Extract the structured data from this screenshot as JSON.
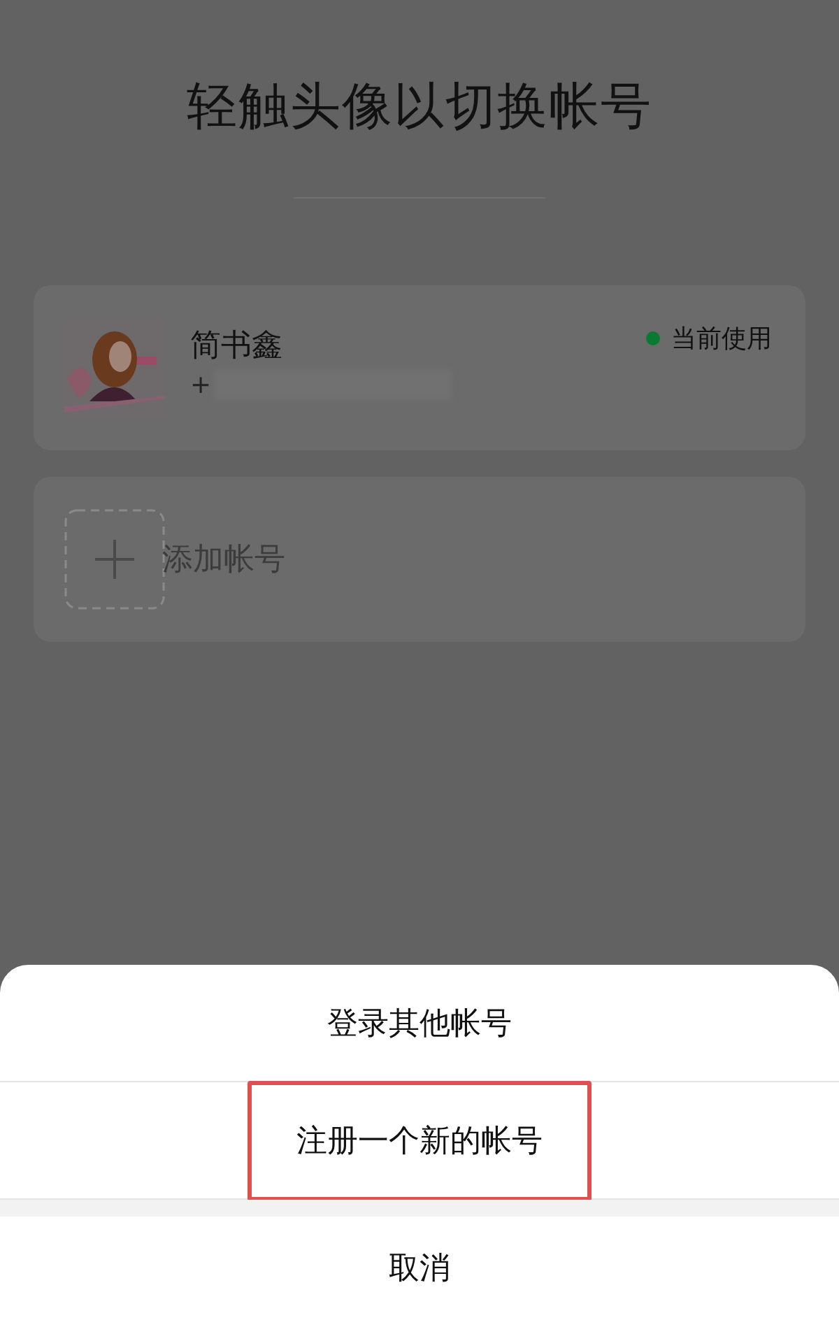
{
  "title": "轻触头像以切换帐号",
  "accounts": [
    {
      "kind": "account",
      "name": "简书鑫",
      "phone": "+",
      "status": "当前使用",
      "current": true
    },
    {
      "kind": "add",
      "label": "添加帐号"
    }
  ],
  "sheet": {
    "options": [
      {
        "label": "登录其他帐号",
        "highlighted": false
      },
      {
        "label": "注册一个新的帐号",
        "highlighted": true
      }
    ],
    "cancel": "取消"
  }
}
